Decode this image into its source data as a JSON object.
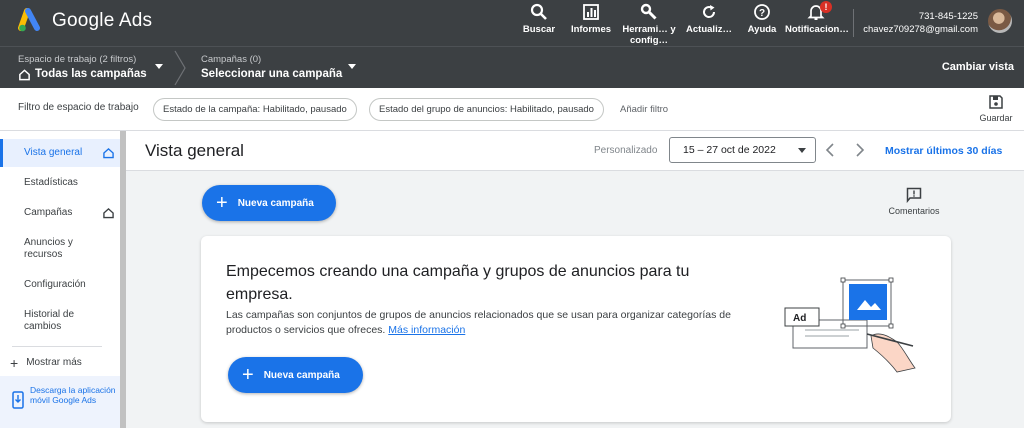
{
  "app": {
    "brand": "Google Ads"
  },
  "topbar": {
    "tools": [
      {
        "label": "Buscar",
        "icon": "search-icon"
      },
      {
        "label": "Informes",
        "icon": "reports-icon"
      },
      {
        "label": "Herrami… y config…",
        "icon": "wrench-icon"
      },
      {
        "label": "Actualiz…",
        "icon": "refresh-icon"
      },
      {
        "label": "Ayuda",
        "icon": "help-icon"
      },
      {
        "label": "Notificacion…",
        "icon": "bell-icon",
        "badge": "!"
      }
    ],
    "account": {
      "id": "731-845-1225",
      "email": "chavez709278@gmail.com"
    }
  },
  "navbar": {
    "workspace_small": "Espacio de trabajo (2 filtros)",
    "workspace_big": "Todas las campañas",
    "campaigns_small": "Campañas (0)",
    "campaigns_big": "Seleccionar una campaña",
    "switch_view": "Cambiar vista"
  },
  "filterbar": {
    "label": "Filtro de espacio de trabajo",
    "chips": [
      "Estado de la campaña: Habilitado, pausado",
      "Estado del grupo de anuncios: Habilitado, pausado"
    ],
    "add_filter": "Añadir filtro",
    "save": "Guardar"
  },
  "sidebar": {
    "items": [
      {
        "label": "Vista general",
        "active": true,
        "home": true
      },
      {
        "label": "Estadísticas"
      },
      {
        "label": "Campañas",
        "home": true
      },
      {
        "label": "Anuncios y recursos"
      },
      {
        "label": "Configuración"
      },
      {
        "label": "Historial de cambios"
      }
    ],
    "more": "Mostrar más",
    "download": "Descarga la aplicación móvil Google Ads"
  },
  "main": {
    "title": "Vista general",
    "date_mode": "Personalizado",
    "date_range": "15 – 27 oct de 2022",
    "last_30": "Mostrar últimos 30 días",
    "new_campaign": "Nueva campaña",
    "comments": "Comentarios",
    "card": {
      "title": "Empecemos creando una campaña y grupos de anuncios para tu empresa.",
      "desc": "Las campañas son conjuntos de grupos de anuncios relacionados que se usan para organizar categorías de productos o servicios que ofreces.",
      "link": "Más información",
      "button": "Nueva campaña",
      "illus_label": "Ad"
    }
  },
  "colors": {
    "topbar": "#3c4043",
    "accent": "#1a73e8",
    "badge": "#d93025"
  }
}
